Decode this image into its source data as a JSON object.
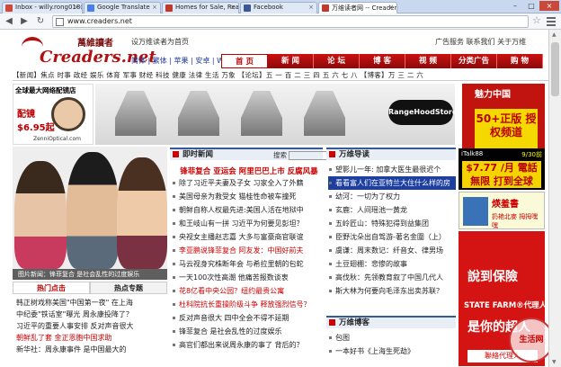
{
  "browser": {
    "tabs": [
      {
        "title": "Inbox - willy.rong018@gm",
        "color": "#d44638"
      },
      {
        "title": "Google Translate",
        "color": "#4a7ee8"
      },
      {
        "title": "Homes for Sale, Real Esta",
        "color": "#c0392b"
      },
      {
        "title": "Facebook",
        "color": "#3b5998"
      },
      {
        "title": "万维读者网 -- Creaders.N",
        "color": "#c0392b"
      }
    ],
    "url": "www.creaders.net"
  },
  "site": {
    "logo_text": "Creaders.net",
    "logo_cn": "萬維讀者",
    "set_home": "设万维读者为首页",
    "enc_links": "简体 | 繁体 | 苹果 | 安卓 | WAP",
    "top_links": "广告服务  联系我们  关于万维",
    "main_nav": [
      "首 页",
      "新 闻",
      "论 坛",
      "博 客",
      "视 频",
      "分类广告",
      "购 物"
    ],
    "sub_nav": "【新闻】焦点 时事 政经 娱乐 体育 军事 财经 科技 健康 法律 生活 万象 【论坛】五 一 百 二 三 四 五 六 七 八 【博客】万 三 二 六"
  },
  "ads": {
    "zenni_title": "全球最大网络配镜店",
    "zenni_price_label": "配镜",
    "zenni_price": "$6.95起",
    "zenni_url": "ZenniOptical.com",
    "rangehood": "RangeHoodStore",
    "meili_title": "魅力中国",
    "meili_offer": "50+正版 授权频道",
    "meili_phone": "1-888-800-7608",
    "italk_name": "iTalk88",
    "italk_date": "9/30前",
    "italk_offer": "$7.77 /月 電話無限 打到全球",
    "qr_title": "煐羞書",
    "qr_sub": "扔艳北麥 拇拇嘿嘿",
    "sf_line1": "說到保險",
    "sf_line2": "STATE FARM®代理人",
    "sf_line3": "是你的超人",
    "sf_btn": "聯絡代理人",
    "watermark": "生活网"
  },
  "photos": {
    "caption": "图片新闻：锋菲复合 是社会乱性的过度娱乐"
  },
  "left_tabs": [
    "热门点击",
    "热点专题"
  ],
  "left_list": [
    {
      "text": "韩正树戏称美国\"中国第一夜\" 在上海",
      "red": false
    },
    {
      "text": "中纪委\"铁话室\"曝光 周永康投降了？",
      "red": false
    },
    {
      "text": "习近平的重要人事安排 反对声音很大",
      "red": false
    },
    {
      "text": "朝鲜乱了套 金正恩胞中国求助",
      "red": true
    },
    {
      "text": "新华社：周永康事件 是中国最大的",
      "red": false
    }
  ],
  "news": {
    "head": "即时新闻",
    "search_label": "搜索",
    "headline": "锋菲复合  亚运会  阿里巴巴上市  反腐风暴",
    "items": [
      {
        "text": "除了习近平夫妻及子女  习家全入了外籍",
        "red": false
      },
      {
        "text": "美国母亲为救受女  猫桂性命被车撞死",
        "red": false
      },
      {
        "text": "朝鲜自称人权最先进:美国人活在地狱中",
        "red": false
      },
      {
        "text": "和王岐山有一拼  习近平为何要见彭坦？",
        "red": false
      },
      {
        "text": "央视女主播赵志嘉  大多与富豪商官联谊",
        "red": false
      },
      {
        "text": "李亚鹏说锋菲复合  阿友发：中国好前夫",
        "red": true
      },
      {
        "text": "马云视身究株断年会  与希拉里朝的包蛇",
        "red": false
      },
      {
        "text": "一天100次性高潮  他痛苦报数谈衷",
        "red": false
      },
      {
        "text": "花8亿看中央公园？纽约最贵公寓",
        "red": true
      },
      {
        "text": "杜科院抗长重操阶级斗争  释放强烈信号？",
        "red": true
      },
      {
        "text": "反对声音很大  四中全会不得不延期",
        "red": false
      },
      {
        "text": "锋菲复合  是社会乱性的过度娱乐",
        "red": false
      },
      {
        "text": "高官们都出来说周永康的事了  背后的？",
        "red": false
      }
    ]
  },
  "guide": {
    "head": "万维导读",
    "items": [
      {
        "text": "望影儿一年: 加拿大医生最很迟个",
        "hl": false
      },
      {
        "text": "看看富人们在亚特兰大住什么样的房",
        "hl": true
      },
      {
        "text": "幼河：一切为了权力",
        "hl": false
      },
      {
        "text": "玄鹿：人间瑶池一黄龙",
        "hl": false
      },
      {
        "text": "五岭匠山：特殊犯得到益集团",
        "hl": false
      },
      {
        "text": "臣野沈朵出自驾游-著名金圍（上）",
        "hl": false
      },
      {
        "text": "虞谦：周末数记：纤音女、律男场",
        "hl": false
      },
      {
        "text": "土豆翅棚：悲惨的故事",
        "hl": false
      },
      {
        "text": "高伐秋：先领教育叙了中国几代人",
        "hl": false
      },
      {
        "text": "斯大林为何要向毛泽东出卖苏联？",
        "hl": false
      }
    ]
  },
  "blogs": {
    "head": "万维博客",
    "items": [
      {
        "text": "包图"
      },
      {
        "text": "一本好书《上海生死劫》"
      }
    ]
  }
}
